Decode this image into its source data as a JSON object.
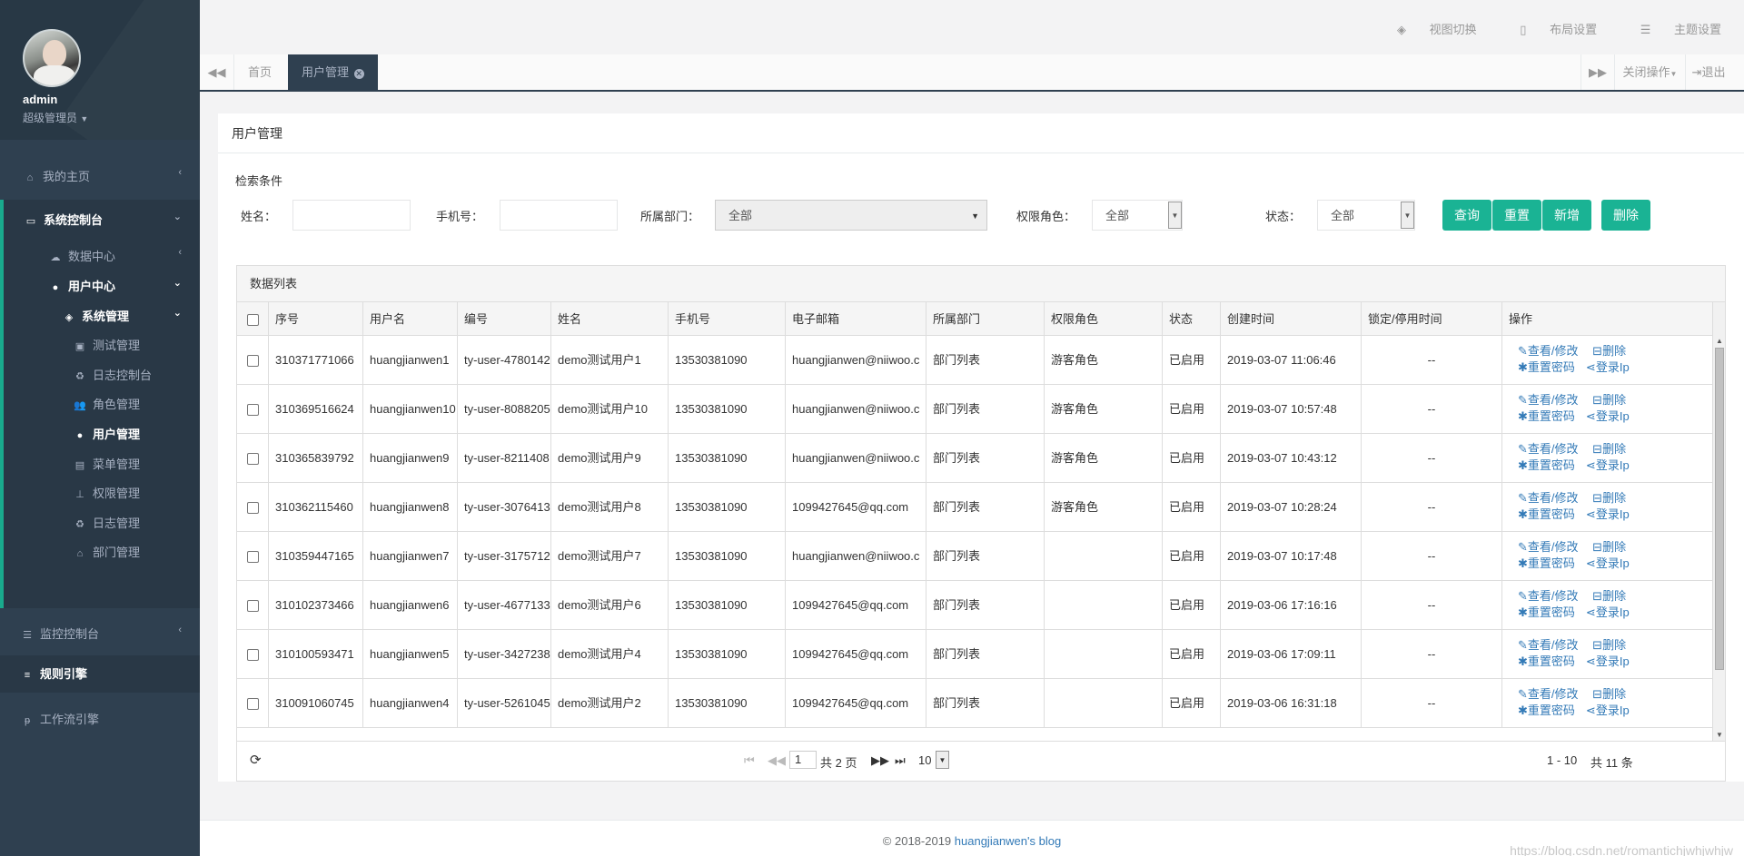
{
  "sidebar": {
    "user": {
      "name": "admin",
      "role": "超级管理员"
    },
    "menu": {
      "home": "我的主页",
      "console": "系统控制台",
      "data_center": "数据中心",
      "user_center": "用户中心",
      "sys_manage": "系统管理",
      "sub_items": [
        "测试管理",
        "日志控制台",
        "角色管理",
        "用户管理",
        "菜单管理",
        "权限管理",
        "日志管理",
        "部门管理"
      ],
      "monitor": "监控控制台",
      "rules": "规则引擎",
      "workflow": "工作流引擎"
    }
  },
  "top": {
    "view_switch": "视图切换",
    "layout": "布局设置",
    "theme": "主题设置"
  },
  "tabs": {
    "home": "首页",
    "active": "用户管理",
    "close_ops": "关闭操作",
    "logout": "退出"
  },
  "panel": {
    "title": "用户管理",
    "search_title": "检索条件",
    "labels": {
      "name": "姓名：",
      "phone": "手机号：",
      "dept": "所属部门：",
      "role": "权限角色：",
      "status": "状态："
    },
    "selects": {
      "dept": "全部",
      "role": "全部",
      "status": "全部"
    },
    "buttons": {
      "query": "查询",
      "reset": "重置",
      "add": "新增",
      "delete": "删除"
    }
  },
  "grid": {
    "caption": "数据列表",
    "columns": [
      "序号",
      "用户名",
      "编号",
      "姓名",
      "手机号",
      "电子邮箱",
      "所属部门",
      "权限角色",
      "状态",
      "创建时间",
      "锁定/停用时间",
      "操作"
    ],
    "rows": [
      [
        "310371771066",
        "huangjianwen1",
        "ty-user-4780142",
        "demo测试用户1",
        "13530381090",
        "huangjianwen@niiwoo.c",
        "部门列表",
        "游客角色",
        "已启用",
        "2019-03-07 11:06:46",
        "--"
      ],
      [
        "310369516624",
        "huangjianwen10",
        "ty-user-8088205",
        "demo测试用户10",
        "13530381090",
        "huangjianwen@niiwoo.c",
        "部门列表",
        "游客角色",
        "已启用",
        "2019-03-07 10:57:48",
        "--"
      ],
      [
        "310365839792",
        "huangjianwen9",
        "ty-user-8211408",
        "demo测试用户9",
        "13530381090",
        "huangjianwen@niiwoo.c",
        "部门列表",
        "游客角色",
        "已启用",
        "2019-03-07 10:43:12",
        "--"
      ],
      [
        "310362115460",
        "huangjianwen8",
        "ty-user-3076413",
        "demo测试用户8",
        "13530381090",
        "1099427645@qq.com",
        "部门列表",
        "游客角色",
        "已启用",
        "2019-03-07 10:28:24",
        "--"
      ],
      [
        "310359447165",
        "huangjianwen7",
        "ty-user-3175712",
        "demo测试用户7",
        "13530381090",
        "huangjianwen@niiwoo.c",
        "部门列表",
        "",
        "已启用",
        "2019-03-07 10:17:48",
        "--"
      ],
      [
        "310102373466",
        "huangjianwen6",
        "ty-user-4677133",
        "demo测试用户6",
        "13530381090",
        "1099427645@qq.com",
        "部门列表",
        "",
        "已启用",
        "2019-03-06 17:16:16",
        "--"
      ],
      [
        "310100593471",
        "huangjianwen5",
        "ty-user-3427238",
        "demo测试用户4",
        "13530381090",
        "1099427645@qq.com",
        "部门列表",
        "",
        "已启用",
        "2019-03-06 17:09:11",
        "--"
      ],
      [
        "310091060745",
        "huangjianwen4",
        "ty-user-5261045",
        "demo测试用户2",
        "13530381090",
        "1099427645@qq.com",
        "部门列表",
        "",
        "已启用",
        "2019-03-06 16:31:18",
        "--"
      ]
    ],
    "actions": {
      "view": "查看/修改",
      "delete": "删除",
      "reset_pwd": "重置密码",
      "login_ip": "登录Ip"
    }
  },
  "pager": {
    "page": "1",
    "total_pages": "共 2 页",
    "page_size": "10",
    "range": "1 - 10",
    "total": "共 11 条"
  },
  "footer": {
    "copyright": "© 2018-2019 ",
    "link": "huangjianwen's blog",
    "watermark": "https://blog.csdn.net/romantichjwhjwhjw"
  }
}
